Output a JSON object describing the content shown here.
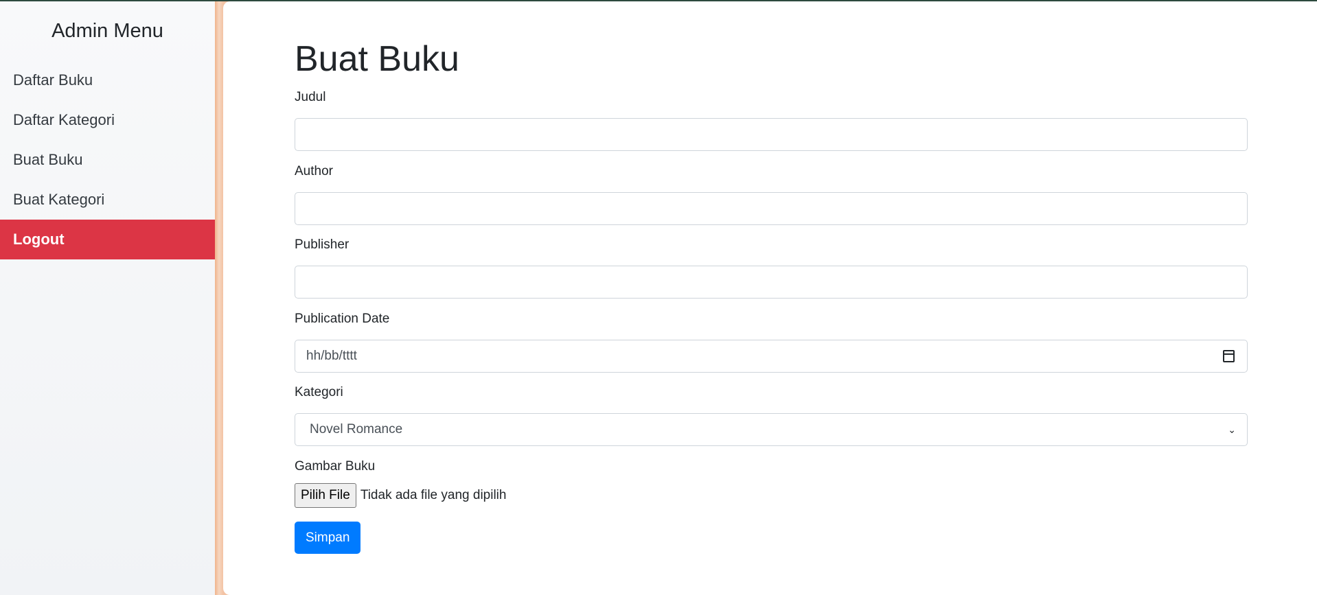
{
  "sidebar": {
    "title": "Admin Menu",
    "items": [
      {
        "label": "Daftar Buku"
      },
      {
        "label": "Daftar Kategori"
      },
      {
        "label": "Buat Buku"
      },
      {
        "label": "Buat Kategori"
      },
      {
        "label": "Logout"
      }
    ],
    "logout_color": "#dc3545"
  },
  "main": {
    "title": "Buat Buku",
    "fields": {
      "judul": {
        "label": "Judul",
        "value": ""
      },
      "author": {
        "label": "Author",
        "value": ""
      },
      "publisher": {
        "label": "Publisher",
        "value": ""
      },
      "publication_date": {
        "label": "Publication Date",
        "placeholder": "hh/bb/tttt",
        "icon": "calendar-icon"
      },
      "kategori": {
        "label": "Kategori",
        "selected": "Novel Romance",
        "icon": "chevron-down-icon"
      },
      "gambar": {
        "label": "Gambar Buku",
        "button_label": "Pilih File",
        "status": "Tidak ada file yang dipilih"
      }
    },
    "submit_label": "Simpan",
    "accent_color": "#007bff"
  }
}
